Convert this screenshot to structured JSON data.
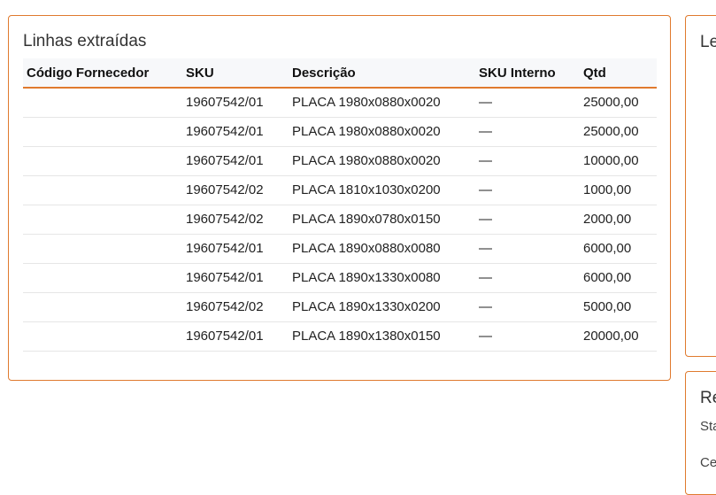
{
  "lines_card": {
    "title": "Linhas extraídas",
    "headers": [
      "Código Fornecedor",
      "SKU",
      "Descrição",
      "SKU Interno",
      "Qtd"
    ],
    "rows": [
      {
        "fornecedor": "",
        "sku": "19607542/01",
        "descricao": "PLACA 1980x0880x0020",
        "sku_interno": "—",
        "qtd": "25000,00"
      },
      {
        "fornecedor": "",
        "sku": "19607542/01",
        "descricao": "PLACA 1980x0880x0020",
        "sku_interno": "—",
        "qtd": "25000,00"
      },
      {
        "fornecedor": "",
        "sku": "19607542/01",
        "descricao": "PLACA 1980x0880x0020",
        "sku_interno": "—",
        "qtd": "10000,00"
      },
      {
        "fornecedor": "",
        "sku": "19607542/02",
        "descricao": "PLACA 1810x1030x0200",
        "sku_interno": "—",
        "qtd": "1000,00"
      },
      {
        "fornecedor": "",
        "sku": "19607542/02",
        "descricao": "PLACA 1890x0780x0150",
        "sku_interno": "—",
        "qtd": "2000,00"
      },
      {
        "fornecedor": "",
        "sku": "19607542/01",
        "descricao": "PLACA 1890x0880x0080",
        "sku_interno": "—",
        "qtd": "6000,00"
      },
      {
        "fornecedor": "",
        "sku": "19607542/01",
        "descricao": "PLACA 1890x1330x0080",
        "sku_interno": "—",
        "qtd": "6000,00"
      },
      {
        "fornecedor": "",
        "sku": "19607542/02",
        "descricao": "PLACA 1890x1330x0200",
        "sku_interno": "—",
        "qtd": "5000,00"
      },
      {
        "fornecedor": "",
        "sku": "19607542/01",
        "descricao": "PLACA 1890x1380x0150",
        "sku_interno": "—",
        "qtd": "20000,00"
      }
    ]
  },
  "right_top_card": {
    "title_fragment": "Le"
  },
  "right_bottom_card": {
    "title_fragment": "Re",
    "line1_fragment": "Sta",
    "line2_fragment": "Ce"
  },
  "colors": {
    "accent": "#e07a2e",
    "header_bg": "#f7f8fa",
    "row_border": "#e6e6e6"
  }
}
